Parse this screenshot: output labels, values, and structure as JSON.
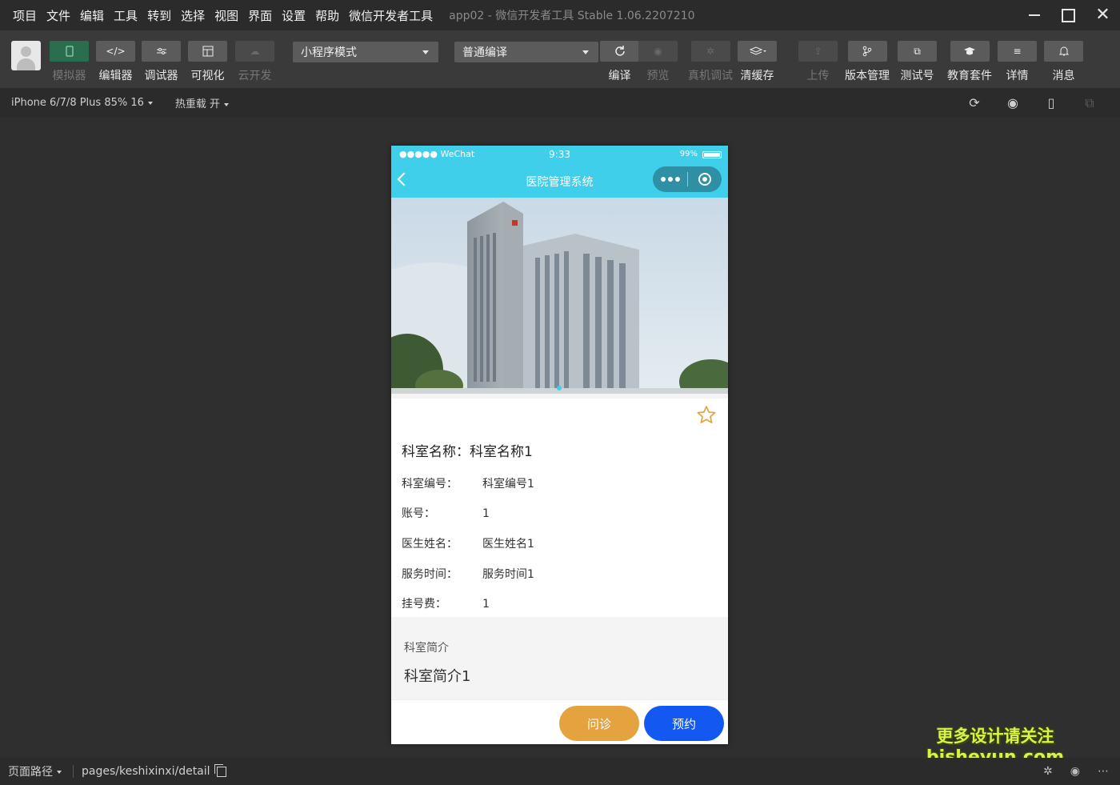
{
  "menu": {
    "items": [
      "项目",
      "文件",
      "编辑",
      "工具",
      "转到",
      "选择",
      "视图",
      "界面",
      "设置",
      "帮助",
      "微信开发者工具"
    ],
    "app_title": "app02 - 微信开发者工具 Stable 1.06.2207210"
  },
  "toolbar": {
    "simulator": "模拟器",
    "editor": "编辑器",
    "debugger": "调试器",
    "visual": "可视化",
    "cloud": "云开发",
    "mode_select": "小程序模式",
    "compile_select": "普通编译",
    "compile": "编译",
    "preview": "预览",
    "remote_debug": "真机调试",
    "clear_cache": "清缓存",
    "upload": "上传",
    "version": "版本管理",
    "test_account": "测试号",
    "edu": "教育套件",
    "details": "详情",
    "messages": "消息"
  },
  "devicebar": {
    "device": "iPhone 6/7/8 Plus 85% 16",
    "hot_reload": "热重载 开"
  },
  "phone": {
    "carrier": "●●●●● WeChat",
    "time": "9:33",
    "battery": "99%",
    "nav_title": "医院管理系统",
    "info_title": "科室名称：科室名称1",
    "fields": [
      {
        "key": "科室编号：",
        "value": "科室编号1"
      },
      {
        "key": "账号：",
        "value": "1"
      },
      {
        "key": "医生姓名：",
        "value": "医生姓名1"
      },
      {
        "key": "服务时间：",
        "value": "服务时间1"
      },
      {
        "key": "挂号费：",
        "value": "1"
      }
    ],
    "intro_heading": "科室简介",
    "intro_text": "科室简介1",
    "consult_button": "问诊",
    "book_button": "预约"
  },
  "bottombar": {
    "path_label": "页面路径",
    "path": "pages/keshixinxi/detail"
  },
  "watermark": {
    "line1": "更多设计请关注",
    "line2": "bisheyun.com"
  },
  "colors": {
    "nav": "#3fcfea",
    "consult": "#e5a33f",
    "book": "#1359f1",
    "star": "#e5a33f"
  }
}
